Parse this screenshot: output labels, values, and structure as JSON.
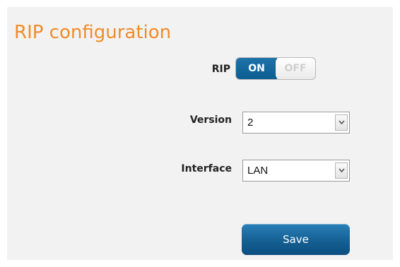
{
  "page": {
    "title": "RIP configuration"
  },
  "form": {
    "rip": {
      "label": "RIP",
      "on_label": "ON",
      "off_label": "OFF",
      "state": "on"
    },
    "version": {
      "label": "Version",
      "value": "2"
    },
    "interface": {
      "label": "Interface",
      "value": "LAN"
    },
    "save_label": "Save"
  },
  "colors": {
    "title": "#f08c2a",
    "accent": "#155f93",
    "panel_bg": "#f2f2f2"
  },
  "icons": {
    "dropdown": "chevron-down-icon"
  }
}
